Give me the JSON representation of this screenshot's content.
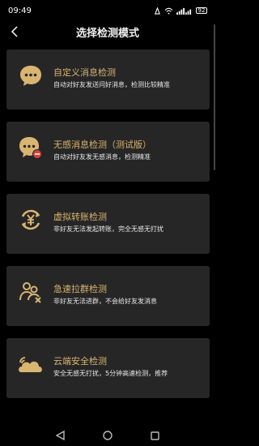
{
  "status": {
    "time": "09:49",
    "battery": "92"
  },
  "header": {
    "title": "选择检测模式"
  },
  "modes": [
    {
      "title": "自定义消息检测",
      "desc": "自动对好友发送问好消息，检测比较精准",
      "icon": "chat-bubble-icon"
    },
    {
      "title": "无感消息检测（测试版）",
      "desc": "自动对好友发无感消息，检测精准",
      "icon": "chat-bubble-minus-icon"
    },
    {
      "title": "虚拟转账检测",
      "desc": "非好友无法发起转账，完全无感无打扰",
      "icon": "yuen-transfer-icon"
    },
    {
      "title": "急速拉群检测",
      "desc": "非好友无法进群，不会给好友发消息",
      "icon": "group-users-icon"
    },
    {
      "title": "云端安全检测",
      "desc": "安全无感无打扰，5分钟高速检测，推荐",
      "icon": "cloud-icon"
    }
  ],
  "colors": {
    "accent": "#D9B572",
    "card_bg": "#262626",
    "background": "#000000"
  }
}
